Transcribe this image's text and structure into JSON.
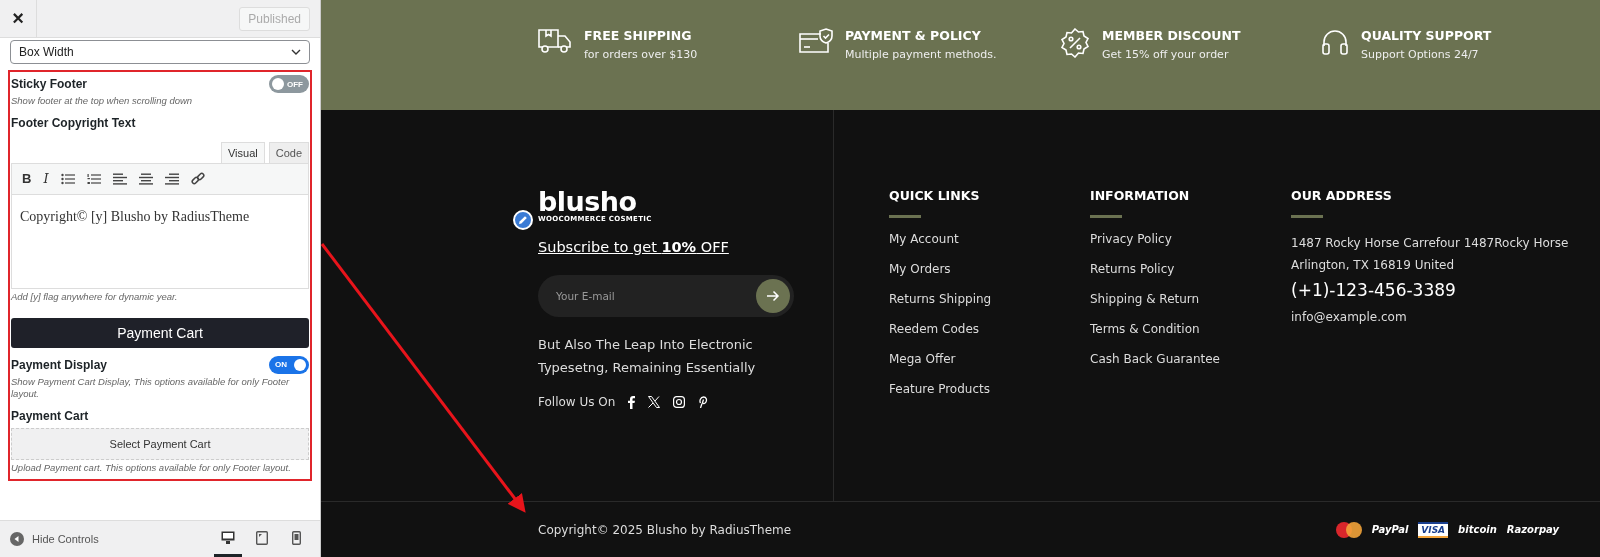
{
  "sidebar": {
    "close": "×",
    "publish_button": "Published",
    "layout_select": {
      "value": "Box Width"
    },
    "settings": [
      {
        "kind": "toggle",
        "label": "Sticky Footer",
        "on": false,
        "toggle_text": "OFF",
        "description": "Show footer at the top when scrolling down"
      },
      {
        "kind": "editor",
        "label": "Footer Copyright Text",
        "tabs": [
          {
            "label": "Visual",
            "selected": true
          },
          {
            "label": "Code",
            "selected": false
          }
        ],
        "bold_button": "B",
        "italic_button": "I",
        "content": "Copyright© [y] Blusho by RadiusTheme",
        "description": "Add [y] flag anywhere for dynamic year."
      },
      {
        "kind": "heading",
        "label": "Payment Cart"
      },
      {
        "kind": "toggle",
        "label": "Payment Display",
        "on": true,
        "toggle_text": "ON",
        "description": "Show Payment Cart Display, This options available for only Footer layout."
      },
      {
        "kind": "upload",
        "label": "Payment Cart",
        "button": "Select Payment Cart",
        "description": "Upload Payment cart. This options available for only Footer layout."
      }
    ],
    "footer_bar": {
      "hide_controls": "Hide Controls",
      "devices": [
        {
          "kind": "desktop",
          "selected": true
        },
        {
          "kind": "tablet",
          "selected": false
        },
        {
          "kind": "mobile",
          "selected": false
        }
      ]
    }
  },
  "features": [
    {
      "kind": "truck",
      "title": "FREE SHIPPING",
      "subtitle": "for orders over $130"
    },
    {
      "kind": "card",
      "title": "PAYMENT & POLICY",
      "subtitle": "Multiple payment methods."
    },
    {
      "kind": "discount",
      "title": "MEMBER DISCOUNT",
      "subtitle": "Get 15% off your order"
    },
    {
      "kind": "headphones",
      "title": "QUALITY SUPPORT",
      "subtitle": "Support Options 24/7"
    }
  ],
  "footer": {
    "logo": {
      "name": "blusho",
      "tagline": "WOOCOMMERCE COSMETIC"
    },
    "subscribe": "Subscribe to get **10%** OFF",
    "email_placeholder": "Your E-mail",
    "about": "But Also The Leap Into Electronic Typesetng, Remaining Essentially",
    "follow": "Follow Us On",
    "socials": [
      {
        "kind": "facebook"
      },
      {
        "kind": "x"
      },
      {
        "kind": "instagram"
      },
      {
        "kind": "pinterest"
      }
    ],
    "columns": [
      {
        "title": "QUICK LINKS",
        "links": [
          "My Account",
          "My Orders",
          "Returns Shipping",
          "Reedem Codes",
          "Mega Offer",
          "Feature Products"
        ]
      },
      {
        "title": "INFORMATION",
        "links": [
          "Privacy Policy",
          "Returns Policy",
          "Shipping & Return",
          "Terms & Condition",
          "Cash Back Guarantee"
        ]
      }
    ],
    "address": {
      "title": "OUR ADDRESS",
      "lines": "1487 Rocky Horse Carrefour 1487Rocky Horse Arlington, TX 16819 United",
      "phone": "(+1)-123-456-3389",
      "email": "info@example.com"
    },
    "copyright": "Copyright© 2025 Blusho by RadiusTheme",
    "payments": [
      {
        "kind": "mastercard"
      },
      {
        "kind": "paypal",
        "text": "PayPal"
      },
      {
        "kind": "visa",
        "text": "VISA"
      },
      {
        "kind": "bitcoin",
        "text": "bitcoin"
      },
      {
        "kind": "razorpay",
        "text": "Razorpay"
      }
    ]
  }
}
